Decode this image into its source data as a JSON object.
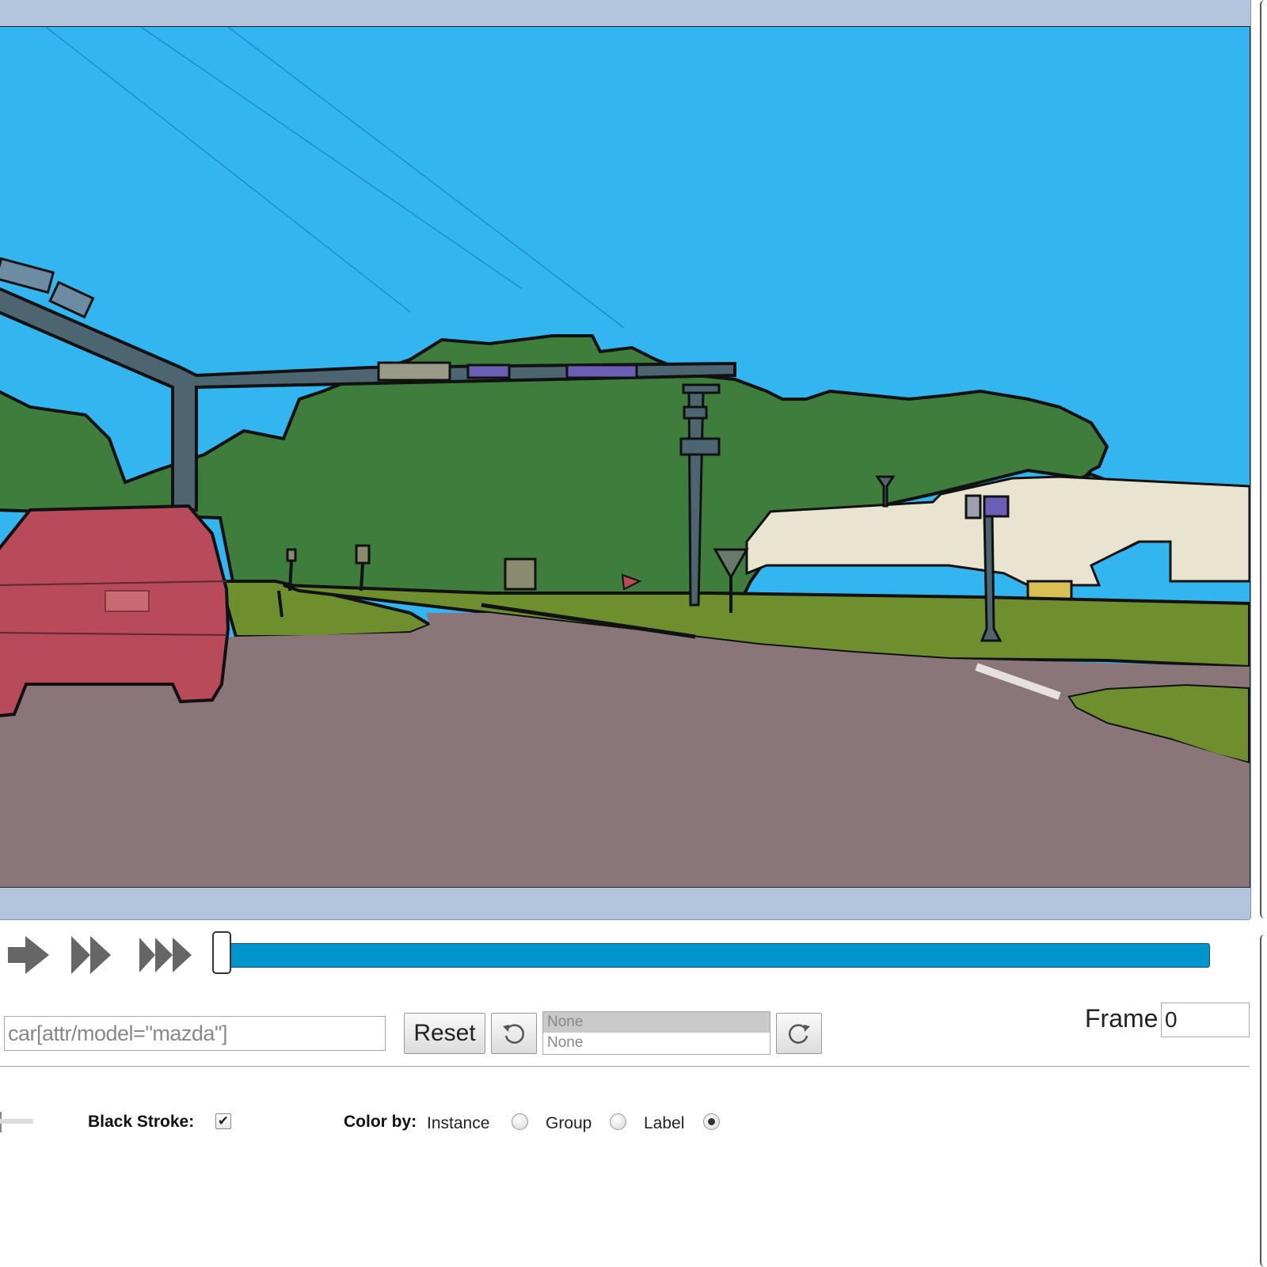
{
  "viewer": {
    "scene": "annotated street scene"
  },
  "playback": {
    "buttons": [
      {
        "name": "play-icon"
      },
      {
        "name": "fast-forward-icon"
      },
      {
        "name": "fastest-forward-icon"
      }
    ],
    "progress": 0
  },
  "query": {
    "value": "car[attr/model=\"mazda\"]",
    "reset_label": "Reset",
    "undo_icon": "undo-icon",
    "redo_icon": "redo-icon",
    "history": [
      "None",
      "None"
    ],
    "frame_label": "Frame",
    "frame_value": "0"
  },
  "options": {
    "black_stroke_label": "Black Stroke:",
    "black_stroke_checked": "✔",
    "color_by_label": "Color by:",
    "color_by_options": [
      "Instance",
      "Group",
      "Label"
    ],
    "color_by_selected": "Label"
  },
  "colors": {
    "sky": "#33b5f0",
    "vegetation": "#3f7d3c",
    "road": "#8a7578",
    "car": "#b84a5a",
    "terrain": "#6f8f2e",
    "building": "#e8e4d0",
    "pole": "#4d6571",
    "traffic_light": "#6a5fb5",
    "slider": "#0094cc"
  }
}
